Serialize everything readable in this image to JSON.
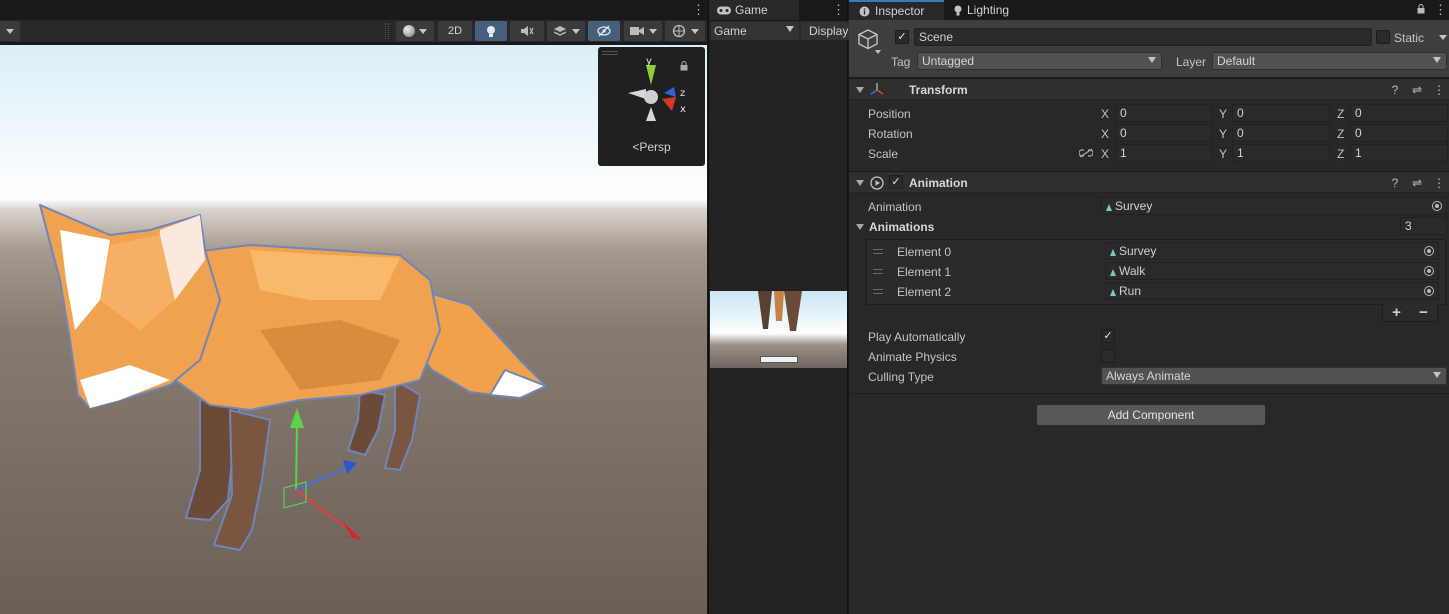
{
  "scene": {
    "btn_2d": "2D",
    "orientation_label": "Persp",
    "axis_y": "y",
    "axis_z": "z",
    "axis_x": "x"
  },
  "game": {
    "tab_label": "Game",
    "view_dropdown": "Game",
    "display_dropdown": "Display"
  },
  "inspector": {
    "tabs": [
      {
        "label": "Inspector"
      },
      {
        "label": "Lighting"
      }
    ],
    "object": {
      "name": "Scene",
      "active": true,
      "static_label": "Static",
      "tag_label": "Tag",
      "tag_value": "Untagged",
      "layer_label": "Layer",
      "layer_value": "Default"
    },
    "transform": {
      "title": "Transform",
      "position_label": "Position",
      "rotation_label": "Rotation",
      "scale_label": "Scale",
      "axis_x": "X",
      "axis_y": "Y",
      "axis_z": "Z",
      "position": {
        "x": "0",
        "y": "0",
        "z": "0"
      },
      "rotation": {
        "x": "0",
        "y": "0",
        "z": "0"
      },
      "scale": {
        "x": "1",
        "y": "1",
        "z": "1"
      }
    },
    "animation": {
      "title": "Animation",
      "enabled": true,
      "animation_label": "Animation",
      "animation_value": "Survey",
      "animations_label": "Animations",
      "animations_count": "3",
      "elements": [
        {
          "label": "Element 0",
          "value": "Survey"
        },
        {
          "label": "Element 1",
          "value": "Walk"
        },
        {
          "label": "Element 2",
          "value": "Run"
        }
      ],
      "add_label": "+",
      "remove_label": "−",
      "play_auto_label": "Play Automatically",
      "play_auto_checked": true,
      "animate_physics_label": "Animate Physics",
      "animate_physics_checked": false,
      "culling_label": "Culling Type",
      "culling_value": "Always Animate"
    },
    "add_component_label": "Add Component"
  },
  "colors": {
    "accent_blue": "#3a79bb",
    "active_toggle": "#46607c",
    "fox_orange": "#f0a251"
  }
}
